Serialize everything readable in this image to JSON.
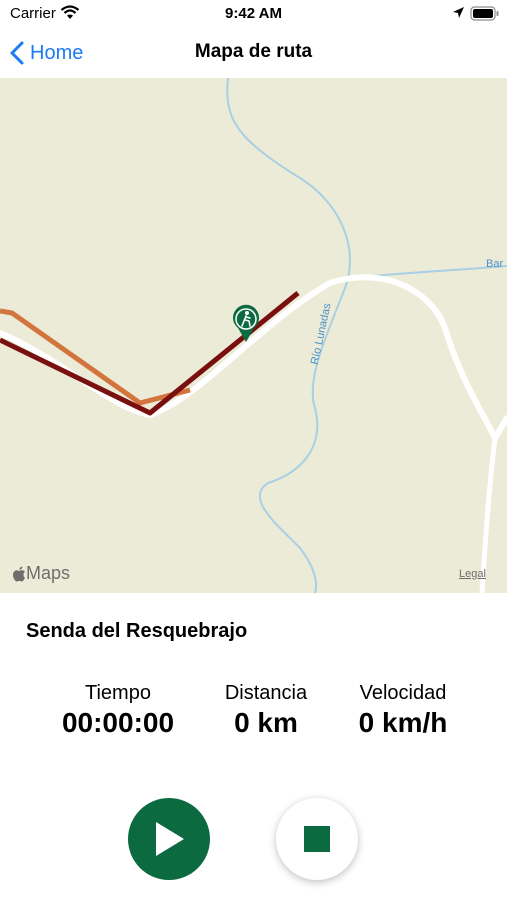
{
  "status_bar": {
    "carrier": "Carrier",
    "time": "9:42 AM"
  },
  "nav": {
    "back_label": "Home",
    "title": "Mapa de ruta"
  },
  "map": {
    "attribution": "Maps",
    "legal": "Legal",
    "road_label": "Bar",
    "river_label": "Río Lunadas"
  },
  "route": {
    "name": "Senda del Resquebrajo"
  },
  "stats": {
    "time": {
      "label": "Tiempo",
      "value": "00:00:00"
    },
    "distance": {
      "label": "Distancia",
      "value": "0 km"
    },
    "speed": {
      "label": "Velocidad",
      "value": "0 km/h"
    }
  },
  "colors": {
    "accent": "#0b6a3f",
    "link": "#1a7cf5",
    "track_dark": "#7a0f0f",
    "track_orange": "#d2743d"
  },
  "icons": {
    "play": "play-icon",
    "stop": "stop-icon",
    "hiker": "hiker-pin-icon"
  }
}
